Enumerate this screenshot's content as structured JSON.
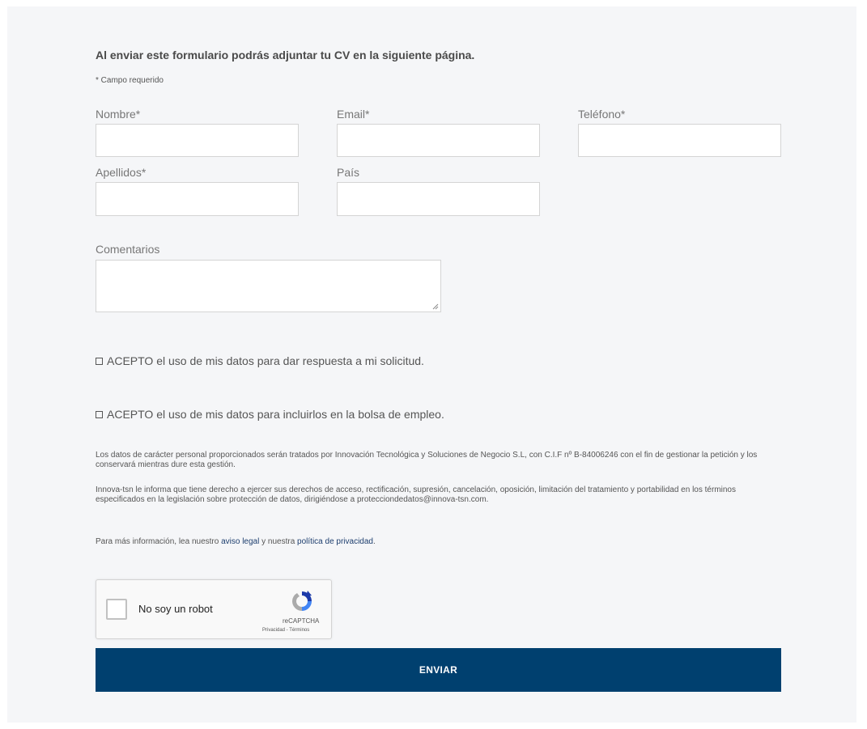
{
  "form": {
    "intro": "Al enviar este formulario podrás adjuntar tu CV en la siguiente página.",
    "required_note": "* Campo requerido",
    "fields": {
      "nombre": {
        "label": "Nombre*",
        "value": ""
      },
      "email": {
        "label": "Email*",
        "value": ""
      },
      "telefono": {
        "label": "Teléfono*",
        "value": ""
      },
      "apellidos": {
        "label": "Apellidos*",
        "value": ""
      },
      "pais": {
        "label": "País",
        "value": ""
      },
      "comentarios": {
        "label": "Comentarios",
        "value": ""
      }
    },
    "consent1": "ACEPTO el uso de mis datos para dar respuesta a mi solicitud.",
    "consent2": "ACEPTO el uso de mis datos para incluirlos en la bolsa de empleo.",
    "legal": {
      "p1": "Los datos de carácter personal proporcionados serán tratados por Innovación Tecnológica y Soluciones de Negocio S.L, con C.I.F nº B-84006246 con el fin de gestionar la petición y los conservará mientras dure esta gestión.",
      "p2": "Innova-tsn le informa que tiene derecho a ejercer sus derechos de acceso, rectificación, supresión, cancelación, oposición, limitación del tratamiento y portabilidad en los términos especificados en la legislación sobre protección de datos, dirigiéndose a protecciondedatos@innova-tsn.com.",
      "p3_prefix": "Para más información, lea nuestro ",
      "link_aviso": "aviso legal",
      "p3_middle": " y nuestra ",
      "link_privacidad": "política de privacidad",
      "p3_suffix": "."
    },
    "captcha": {
      "label": "No soy un robot",
      "brand": "reCAPTCHA",
      "links": "Privacidad - Términos"
    },
    "submit_label": "ENVIAR"
  },
  "colors": {
    "primary": "#00406f",
    "link": "#1d3e6e",
    "background": "#f5f6f8"
  }
}
